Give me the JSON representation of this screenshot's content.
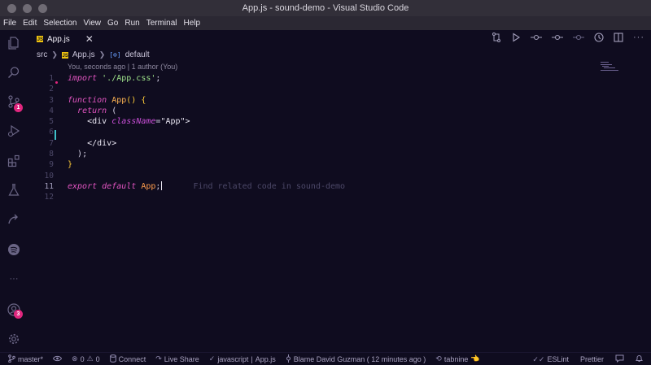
{
  "window": {
    "title": "App.js - sound-demo - Visual Studio Code"
  },
  "menu": [
    "File",
    "Edit",
    "Selection",
    "View",
    "Go",
    "Run",
    "Terminal",
    "Help"
  ],
  "activity": {
    "source_control_badge": "1",
    "accounts_badge": "3",
    "more": "···"
  },
  "tab": {
    "label": "App.js",
    "close": "✕",
    "icon": "JS"
  },
  "breadcrumb": {
    "folder": "src",
    "file": "App.js",
    "symbol_icon": "[⊚]",
    "symbol": "default"
  },
  "blame_header": "You, seconds ago | 1 author (You)",
  "line_numbers": [
    "1",
    "2",
    "3",
    "4",
    "5",
    "6",
    "7",
    "8",
    "9",
    "10",
    "11",
    "12"
  ],
  "code": {
    "l1_kw": "import",
    "l1_str": "'./App.css'",
    "l1_end": ";",
    "l3_kw": "function",
    "l3_name": "App",
    "l3_rest": "() {",
    "l4_kw": "return",
    "l4_rest": " (",
    "l5_open": "<div",
    "l5_attr": "className",
    "l5_eq": "=",
    "l5_val": "\"App\"",
    "l5_close": ">",
    "l7": "</div>",
    "l8": ");",
    "l9": "}",
    "l11_kw1": "export",
    "l11_kw2": "default",
    "l11_ident": "App",
    "l11_end": ";",
    "l11_hint": "Find related code in sound-demo"
  },
  "status": {
    "branch": "master*",
    "errors": "0",
    "warnings": "0",
    "connect": "Connect",
    "liveshare": "Live Share",
    "language": "javascript",
    "file": "App.js",
    "blame": "Blame David Guzman ( 12 minutes ago )",
    "tabnine": "tabnine",
    "eslint": "ESLint",
    "prettier": "Prettier"
  },
  "colors": {
    "accent_badge": "#e0267e",
    "editor_bg": "#0f0c1f",
    "titlebar_bg": "#322f39"
  }
}
